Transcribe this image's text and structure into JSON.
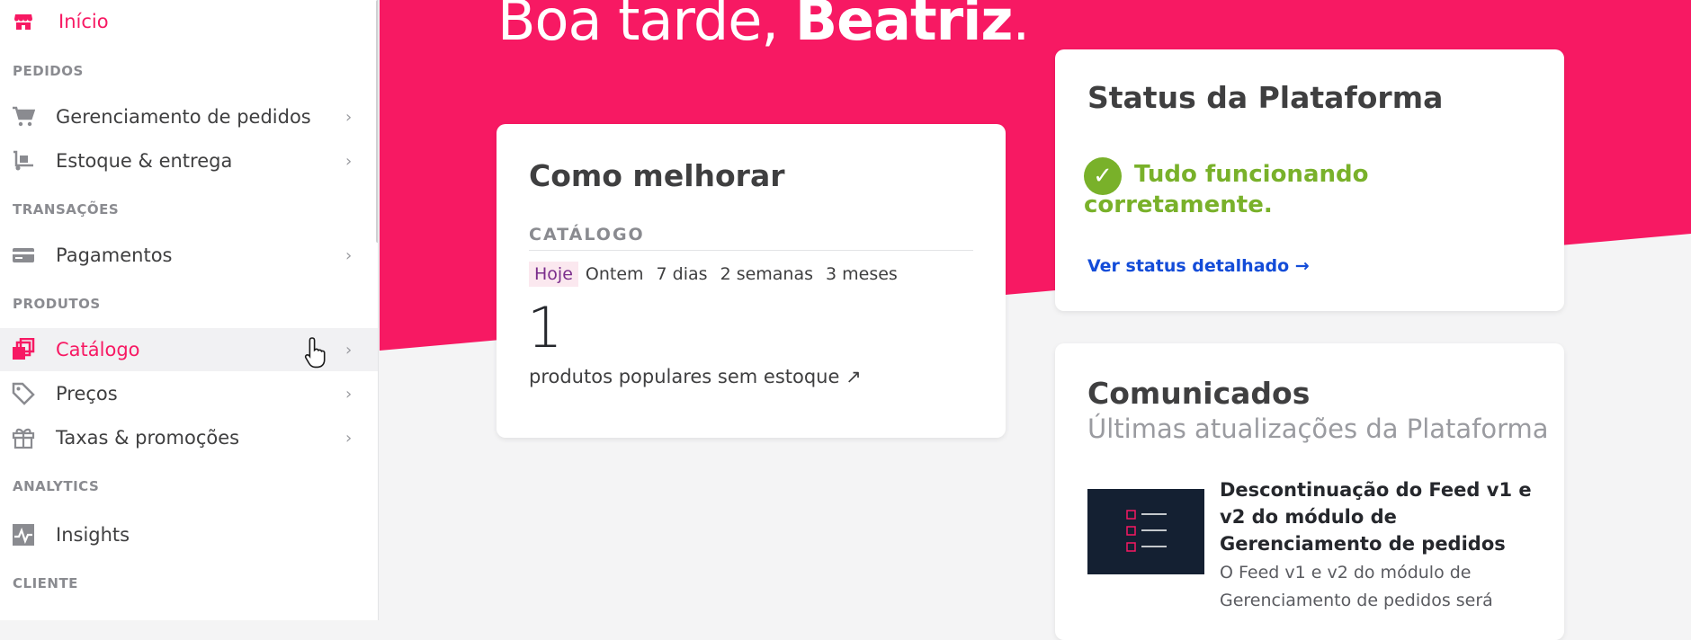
{
  "sidebar": {
    "home": {
      "label": "Início",
      "icon": "store-icon"
    },
    "sections": {
      "orders": "PEDIDOS",
      "transactions": "TRANSAÇÕES",
      "products": "PRODUTOS",
      "analytics": "ANALYTICS",
      "customer": "CLIENTE"
    },
    "items": {
      "order_management": {
        "label": "Gerenciamento de pedidos",
        "icon": "cart-icon"
      },
      "inventory": {
        "label": "Estoque & entrega",
        "icon": "hand-truck-icon"
      },
      "payments": {
        "label": "Pagamentos",
        "icon": "credit-card-icon"
      },
      "catalog": {
        "label": "Catálogo",
        "icon": "catalog-icon"
      },
      "prices": {
        "label": "Preços",
        "icon": "tag-icon"
      },
      "promotions": {
        "label": "Taxas & promoções",
        "icon": "gift-icon"
      },
      "insights": {
        "label": "Insights",
        "icon": "chart-pulse-icon"
      }
    },
    "chevron": "›"
  },
  "greeting": {
    "prefix": "Boa tarde,",
    "name": "Beatriz",
    "suffix": "."
  },
  "improve_card": {
    "title": "Como melhorar",
    "section": "CATÁLOGO",
    "periods": [
      "Hoje",
      "Ontem",
      "7 dias",
      "2 semanas",
      "3 meses"
    ],
    "selected_period": "Hoje",
    "metric_value": "1",
    "metric_label": "produtos populares sem estoque ↗"
  },
  "status_card": {
    "title": "Status da Plataforma",
    "status_text": "Tudo funcionando corretamente.",
    "status_check": "✓",
    "link": "Ver status detalhado →"
  },
  "news_card": {
    "title": "Comunicados",
    "subtitle": "Últimas atualizações da Plataforma",
    "item_title": "Descontinuação do Feed v1 e v2 do módulo de Gerenciamento de pedidos",
    "item_body": "O Feed v1 e v2 do módulo de Gerenciamento de pedidos será"
  },
  "colors": {
    "brand_pink": "#f71963",
    "success_green": "#79b12a",
    "link_blue": "#134cd8"
  }
}
